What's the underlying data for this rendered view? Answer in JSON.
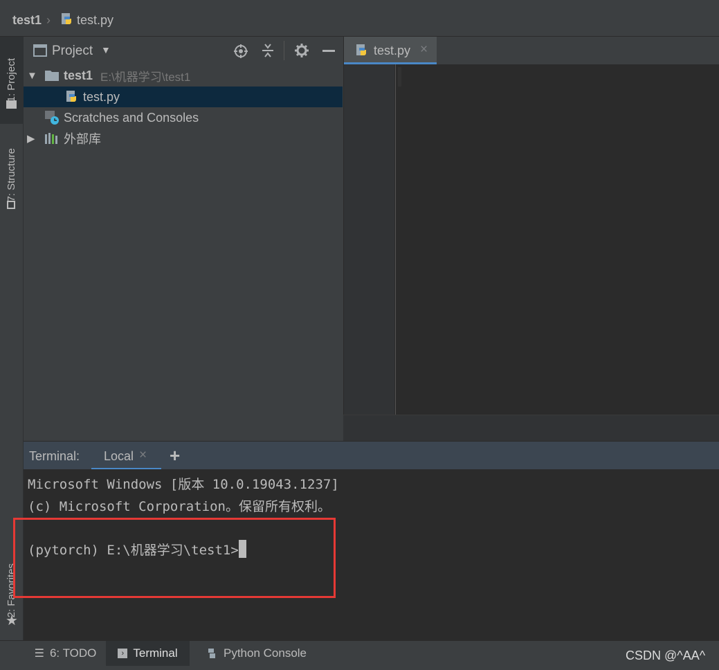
{
  "breadcrumb": {
    "project": "test1",
    "file": "test.py"
  },
  "left_stripe": {
    "project_tab": "1: Project",
    "structure_tab": "7: Structure",
    "favorites_tab": "2: Favorites"
  },
  "project_panel": {
    "title": "Project",
    "tree": {
      "root_name": "test1",
      "root_path": "E:\\机器学习\\test1",
      "file": "test.py",
      "scratches": "Scratches and Consoles",
      "external_libs": "外部库"
    }
  },
  "editor": {
    "tab_label": "test.py"
  },
  "terminal": {
    "title": "Terminal:",
    "tab_label": "Local",
    "lines": [
      "Microsoft Windows [版本 10.0.19043.1237]",
      "(c) Microsoft Corporation。保留所有权利。",
      "(pytorch) E:\\机器学习\\test1>"
    ]
  },
  "bottom_tabs": {
    "todo": "6: TODO",
    "terminal": "Terminal",
    "python_console": "Python Console"
  },
  "watermark": "CSDN @^AA^",
  "colors": {
    "background": "#3c3f41",
    "editor_bg": "#2b2b2b",
    "selection": "#0d293e",
    "tab_underline": "#4a88c7",
    "highlight_box": "#e53935"
  }
}
